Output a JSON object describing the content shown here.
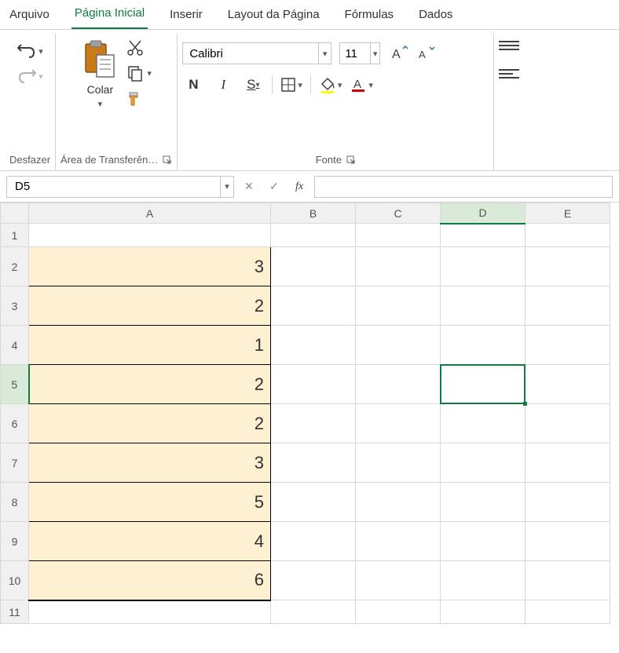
{
  "tabs": {
    "arquivo": "Arquivo",
    "pagina_inicial": "Página Inicial",
    "inserir": "Inserir",
    "layout": "Layout da Página",
    "formulas": "Fórmulas",
    "dados": "Dados"
  },
  "ribbon": {
    "desfazer_label": "Desfazer",
    "transferencia_label": "Área de Transferên…",
    "colar_label": "Colar",
    "fonte_label": "Fonte",
    "font_name": "Calibri",
    "font_size": "11"
  },
  "formula_bar": {
    "name_box": "D5",
    "formula": ""
  },
  "columns": [
    "A",
    "B",
    "C",
    "D",
    "E"
  ],
  "rows": [
    "1",
    "2",
    "3",
    "4",
    "5",
    "6",
    "7",
    "8",
    "9",
    "10",
    "11"
  ],
  "colA_values": {
    "2": "3",
    "3": "2",
    "4": "1",
    "5": "2",
    "6": "2",
    "7": "3",
    "8": "5",
    "9": "4",
    "10": "6"
  },
  "active_cell": {
    "row": "5",
    "col": "D"
  }
}
